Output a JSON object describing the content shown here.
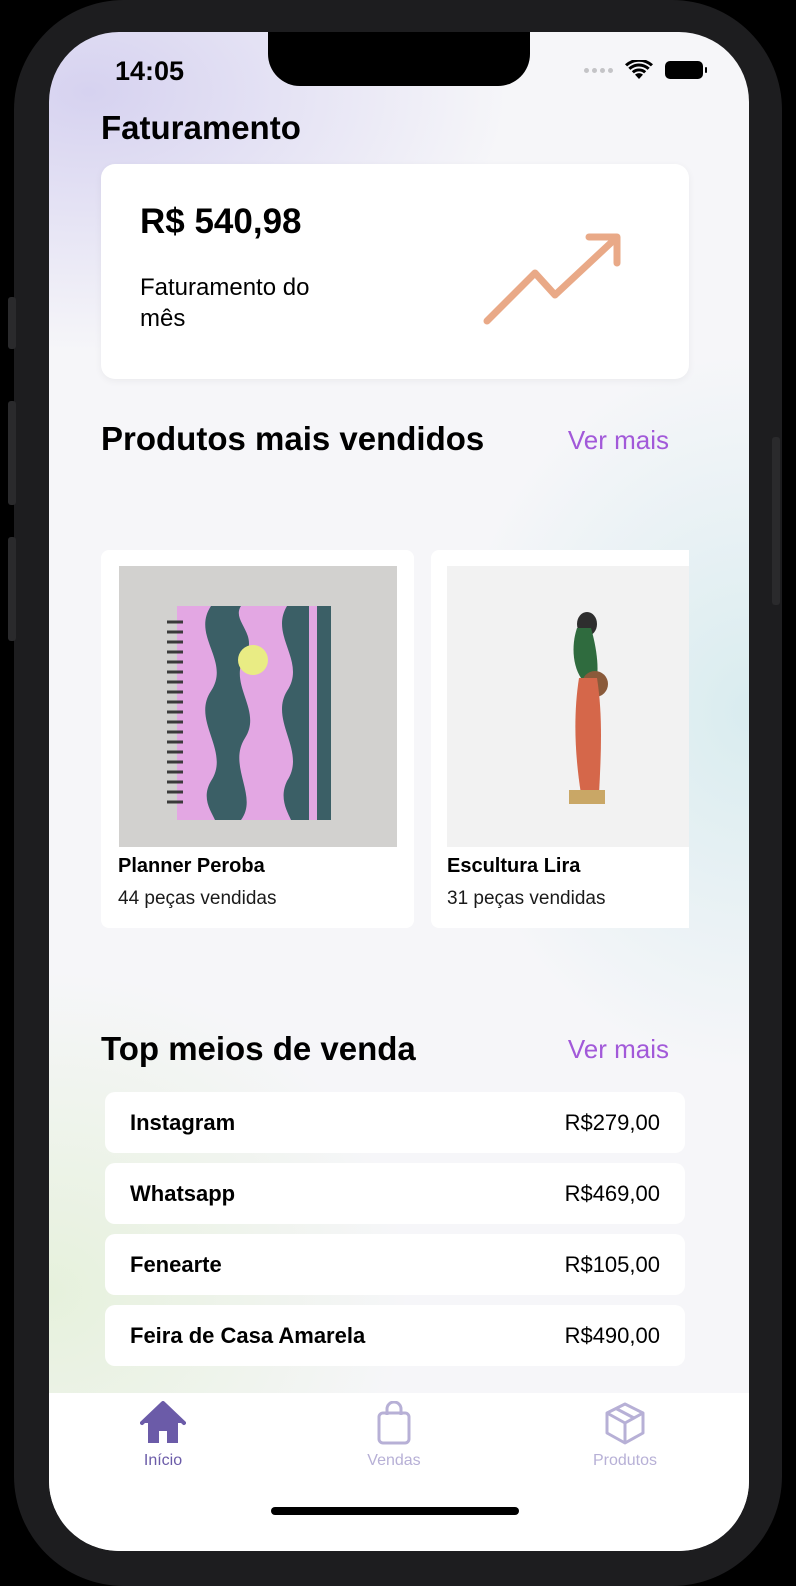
{
  "status_bar": {
    "time": "14:05"
  },
  "revenue": {
    "section_title": "Faturamento",
    "value": "R$ 540,98",
    "label": "Faturamento do mês",
    "trend_color": "#e9a987"
  },
  "best_sellers": {
    "title": "Produtos mais vendidos",
    "see_more": "Ver mais",
    "products": [
      {
        "name": "Planner Peroba",
        "sold": "44 peças vendidas"
      },
      {
        "name": "Escultura Lira",
        "sold": "31 peças vendidas"
      }
    ]
  },
  "sales_channels": {
    "title": "Top meios de venda",
    "see_more": "Ver mais",
    "items": [
      {
        "name": "Instagram",
        "value": "R$279,00"
      },
      {
        "name": "Whatsapp",
        "value": "R$469,00"
      },
      {
        "name": "Fenearte",
        "value": "R$105,00"
      },
      {
        "name": "Feira de Casa Amarela",
        "value": "R$490,00"
      }
    ]
  },
  "tab_bar": {
    "tabs": [
      {
        "label": "Início",
        "icon": "home-icon",
        "active": true
      },
      {
        "label": "Vendas",
        "icon": "shopping-bag-icon",
        "active": false
      },
      {
        "label": "Produtos",
        "icon": "box-icon",
        "active": false
      }
    ]
  },
  "colors": {
    "accent": "#a259d9",
    "tab_active": "#6b5ba8",
    "tab_inactive": "#b7b0d6"
  }
}
